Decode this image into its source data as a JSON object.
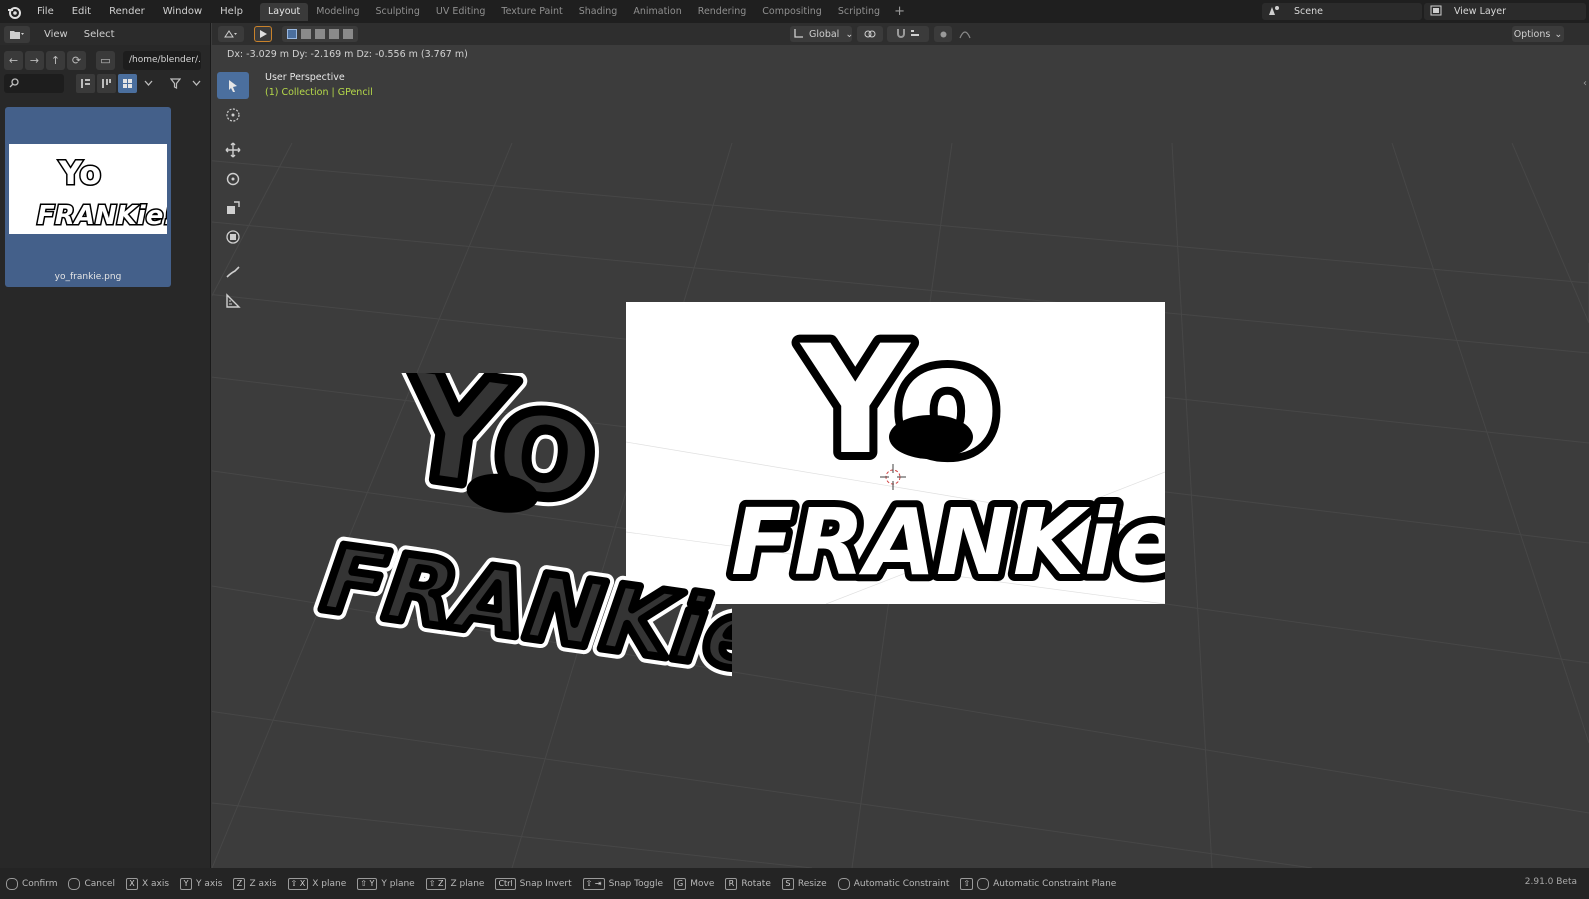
{
  "menubar": {
    "items": [
      "File",
      "Edit",
      "Render",
      "Window",
      "Help"
    ],
    "workspaces": [
      "Layout",
      "Modeling",
      "Sculpting",
      "UV Editing",
      "Texture Paint",
      "Shading",
      "Animation",
      "Rendering",
      "Compositing",
      "Scripting"
    ],
    "active_workspace": "Layout",
    "add_label": "+",
    "scene": "Scene",
    "view_layer": "View Layer"
  },
  "file_browser": {
    "menu": [
      "View",
      "Select"
    ],
    "path": "/home/blender/...",
    "files": [
      {
        "name": "yo_frankie.png"
      }
    ]
  },
  "viewport": {
    "orientation": "Global",
    "options_label": "Options",
    "transform_readout": "Dx: -3.029 m  Dy: -2.169 m  Dz: -0.556 m (3.767 m)",
    "view_title": "User Perspective",
    "view_subtitle": "(1) Collection | GPencil",
    "logo_text_top": "Yo",
    "logo_text_bottom": "FRANKie!"
  },
  "statusbar": {
    "items": [
      {
        "key": "",
        "label": "Confirm"
      },
      {
        "key": "",
        "label": "Cancel"
      },
      {
        "key": "X",
        "label": "X axis"
      },
      {
        "key": "Y",
        "label": "Y axis"
      },
      {
        "key": "Z",
        "label": "Z axis"
      },
      {
        "key": "⇧ X",
        "label": "X plane"
      },
      {
        "key": "⇧ Y",
        "label": "Y plane"
      },
      {
        "key": "⇧ Z",
        "label": "Z plane"
      },
      {
        "key": "Ctrl",
        "label": "Snap Invert"
      },
      {
        "key": "⇧ ⇥",
        "label": "Snap Toggle"
      },
      {
        "key": "G",
        "label": "Move"
      },
      {
        "key": "R",
        "label": "Rotate"
      },
      {
        "key": "S",
        "label": "Resize"
      },
      {
        "key": "",
        "label": "Automatic Constraint"
      },
      {
        "key": "⇧",
        "label": "Automatic Constraint Plane"
      }
    ],
    "version": "2.91.0 Beta"
  },
  "colors": {
    "accent": "#4b6f9e",
    "viewport_bg": "#3c3c3c",
    "grid": "#464646",
    "subtitle": "#b6d94a"
  }
}
